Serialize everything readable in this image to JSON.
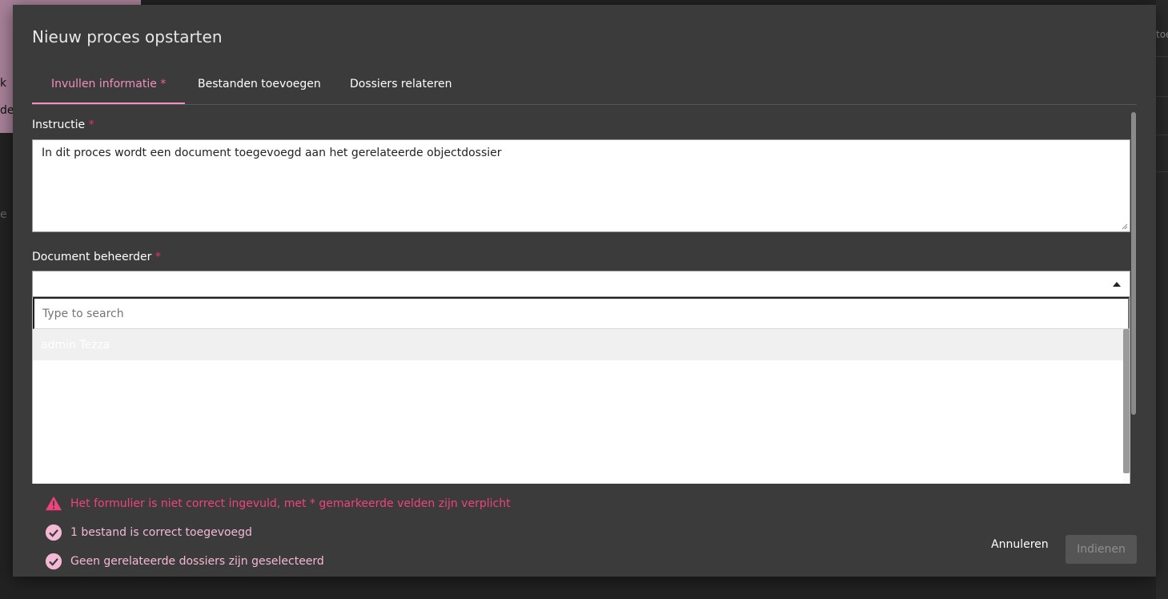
{
  "background": {
    "fragments": [
      "k",
      "de",
      "e"
    ],
    "right_text": "toe"
  },
  "modal": {
    "title": "Nieuw proces opstarten",
    "tabs": [
      {
        "label": "Invullen informatie",
        "required_mark": "*",
        "active": true
      },
      {
        "label": "Bestanden toevoegen",
        "active": false
      },
      {
        "label": "Dossiers relateren",
        "active": false
      }
    ],
    "instruction": {
      "label": "Instructie",
      "required_mark": "*",
      "value": "In dit proces wordt een document toegevoegd aan het gerelateerde objectdossier"
    },
    "document_owner": {
      "label": "Document beheerder",
      "required_mark": "*",
      "value": "",
      "search_placeholder": "Type to search",
      "options": [
        "admin Tezza"
      ]
    },
    "status_messages": [
      {
        "type": "error",
        "icon": "warning-icon",
        "text": "Het formulier is niet correct ingevuld, met * gemarkeerde velden zijn verplicht"
      },
      {
        "type": "ok",
        "icon": "check-circle-icon",
        "text": "1 bestand is correct toegevoegd"
      },
      {
        "type": "ok",
        "icon": "check-circle-icon",
        "text": "Geen gerelateerde dossiers zijn geselecteerd"
      }
    ],
    "buttons": {
      "cancel": "Annuleren",
      "submit": "Indienen"
    }
  },
  "colors": {
    "accent": "#f28fbf",
    "error": "#f0437c",
    "required": "#e8306a",
    "success": "#f4b8d6",
    "modal_bg": "#3b3b3b"
  }
}
